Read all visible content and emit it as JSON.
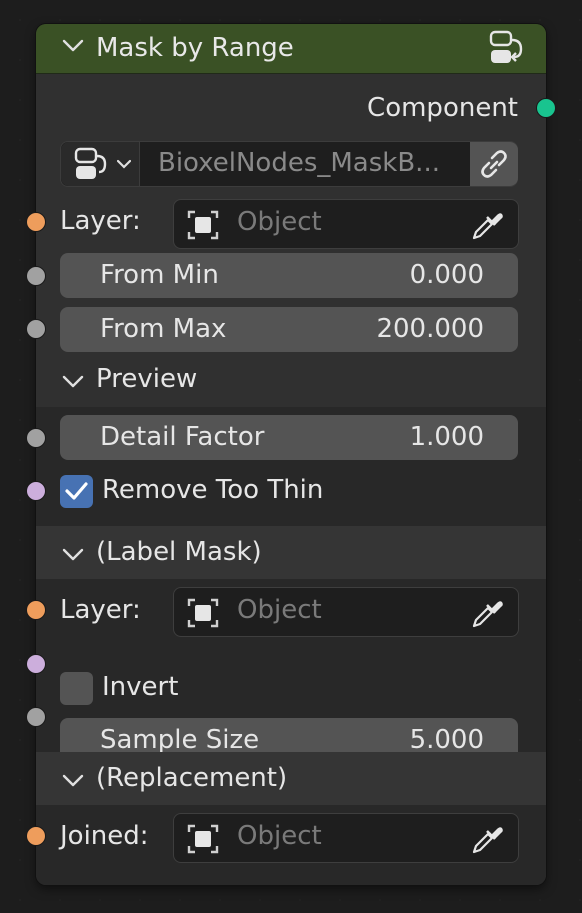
{
  "node": {
    "title": "Mask by Range",
    "icon": "node-group-icon",
    "header_color": "#3a5125"
  },
  "outputs": {
    "component_label": "Component",
    "component_socket_color": "#19c48f"
  },
  "node_group": {
    "name": "BioxelNodes_MaskB...",
    "icon": "node-tree-icon",
    "link_icon": "link-icon"
  },
  "inputs": {
    "layer": {
      "label": "Layer:",
      "placeholder": "Object"
    },
    "from_min": {
      "label": "From Min",
      "value": "0.000"
    },
    "from_max": {
      "label": "From Max",
      "value": "200.000"
    }
  },
  "preview": {
    "title": "Preview",
    "detail_factor": {
      "label": "Detail Factor",
      "value": "1.000"
    },
    "remove_too_thin": {
      "label": "Remove Too Thin",
      "checked": true
    }
  },
  "label_mask": {
    "title": "(Label Mask)",
    "layer": {
      "label": "Layer:",
      "placeholder": "Object"
    },
    "invert": {
      "label": "Invert",
      "checked": false
    },
    "sample_size": {
      "label": "Sample Size",
      "value": "5.000"
    }
  },
  "replacement": {
    "title": "(Replacement)",
    "joined": {
      "label": "Joined:",
      "placeholder": "Object"
    }
  },
  "colors": {
    "object_socket": "#ee9d5c",
    "float_socket": "#a1a1a1",
    "bool_socket": "#ccaedc",
    "checkbox_on": "#4772b3"
  }
}
